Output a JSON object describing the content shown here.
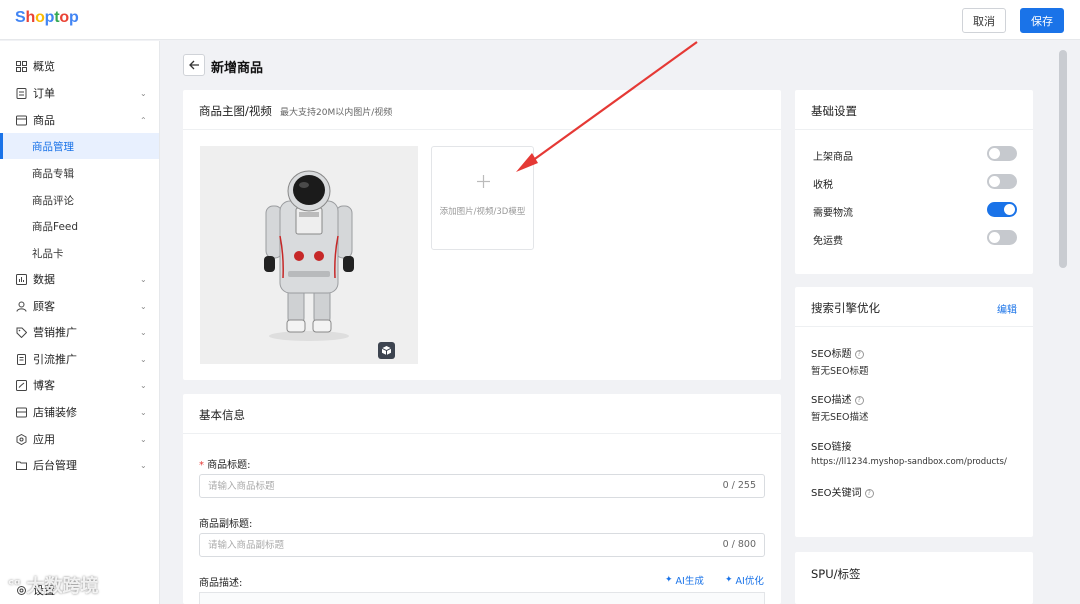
{
  "app": {
    "logo_letters": [
      "S",
      "h",
      "o",
      "p",
      "t",
      "o",
      "p"
    ],
    "logo_colors": [
      "#4285f4",
      "#ea4335",
      "#fbbc05",
      "#4285f4",
      "#34a853",
      "#ea4335",
      "#4285f4"
    ]
  },
  "header": {
    "cancel_label": "取消",
    "save_label": "保存"
  },
  "sidebar": {
    "items": [
      {
        "label": "概览",
        "icon": "grid-icon",
        "chev": ""
      },
      {
        "label": "订单",
        "icon": "receipt-icon",
        "chev": "⌄"
      },
      {
        "label": "商品",
        "icon": "box-icon",
        "chev": "⌃"
      },
      {
        "label": "数据",
        "icon": "chart-icon",
        "chev": "⌄"
      },
      {
        "label": "顾客",
        "icon": "user-icon",
        "chev": "⌄"
      },
      {
        "label": "营销推广",
        "icon": "tag-icon",
        "chev": "⌄"
      },
      {
        "label": "引流推广",
        "icon": "document-icon",
        "chev": "⌄"
      },
      {
        "label": "博客",
        "icon": "blog-icon",
        "chev": "⌄"
      },
      {
        "label": "店铺装修",
        "icon": "store-icon",
        "chev": "⌄"
      },
      {
        "label": "应用",
        "icon": "hexagon-icon",
        "chev": "⌄"
      },
      {
        "label": "后台管理",
        "icon": "folder-icon",
        "chev": "⌄"
      }
    ],
    "sub_items": [
      {
        "label": "商品管理",
        "active": true
      },
      {
        "label": "商品专辑"
      },
      {
        "label": "商品评论"
      },
      {
        "label": "商品Feed"
      },
      {
        "label": "礼品卡"
      }
    ],
    "footer_label": "设置"
  },
  "page": {
    "title": "新增商品"
  },
  "media": {
    "title": "商品主图/视频",
    "hint": "最大支持20M以内图片/视频",
    "add_label": "添加图片/视频/3D模型",
    "add_icon": "plus-icon",
    "model_badge_icon": "cube-icon"
  },
  "basic": {
    "title": "基本信息",
    "required_mark": "*",
    "title_label": "商品标题:",
    "title_placeholder": "请输入商品标题",
    "title_counter": "0 / 255",
    "subtitle_label": "商品副标题:",
    "subtitle_placeholder": "请输入商品副标题",
    "subtitle_counter": "0 / 800",
    "desc_label": "商品描述:",
    "ai_generate": "AI生成",
    "ai_optimize": "AI优化"
  },
  "settings": {
    "title": "基础设置",
    "toggles": [
      {
        "label": "上架商品",
        "on": false
      },
      {
        "label": "收税",
        "on": false
      },
      {
        "label": "需要物流",
        "on": true
      },
      {
        "label": "免运费",
        "on": false
      }
    ]
  },
  "seo": {
    "title": "搜索引擎优化",
    "edit_label": "编辑",
    "seo_title_label": "SEO标题",
    "seo_title_value": "暂无SEO标题",
    "seo_desc_label": "SEO描述",
    "seo_desc_value": "暂无SEO描述",
    "seo_link_label": "SEO链接",
    "seo_link_value": "https://ll1234.myshop-sandbox.com/products/",
    "seo_keywords_label": "SEO关键词"
  },
  "spu": {
    "title": "SPU/标签"
  },
  "watermark": {
    "text": "大数跨境"
  },
  "colors": {
    "accent": "#1a73e8",
    "annotation_arrow": "#e53935"
  }
}
